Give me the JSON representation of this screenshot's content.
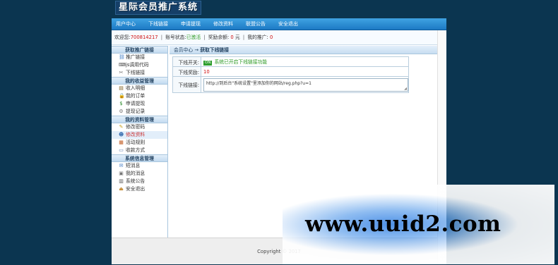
{
  "app": {
    "title": "星际会员推广系统"
  },
  "nav": [
    "用户中心",
    "下线链接",
    "申请提现",
    "修改资料",
    "联盟公告",
    "安全退出"
  ],
  "info": {
    "welcome": "欢迎您:",
    "user": "700814217",
    "status_label": "账号状态:",
    "status_value": "已激活",
    "reward_label": "奖励余额:",
    "reward_value": "0",
    "unit": "元",
    "promo_label": "我的推广:",
    "promo_value": "0"
  },
  "sidebar": [
    {
      "header": "获取推广链接",
      "items": [
        {
          "label": "推广链接",
          "icon": "link-icon"
        },
        {
          "label": "js调用代码",
          "icon": "code-icon"
        },
        {
          "label": "下线链接",
          "icon": "tools-icon"
        }
      ]
    },
    {
      "header": "我的收益管理",
      "items": [
        {
          "label": "收入明细",
          "icon": "document-icon"
        },
        {
          "label": "我的订单",
          "icon": "lock-icon"
        },
        {
          "label": "申请提现",
          "icon": "money-icon"
        },
        {
          "label": "提现记录",
          "icon": "gear-icon"
        }
      ]
    },
    {
      "header": "我的资料管理",
      "items": [
        {
          "label": "修改密码",
          "icon": "pencil-icon"
        },
        {
          "label": "修改资料",
          "icon": "users-icon"
        },
        {
          "label": "活动规则",
          "icon": "rules-icon"
        },
        {
          "label": "收款方式",
          "icon": "card-icon"
        }
      ]
    },
    {
      "header": "系统信息管理",
      "items": [
        {
          "label": "短消息",
          "icon": "message-icon"
        },
        {
          "label": "我的消息",
          "icon": "inbox-icon"
        },
        {
          "label": "系统公告",
          "icon": "notice-icon"
        },
        {
          "label": "安全退出",
          "icon": "logout-icon"
        }
      ]
    }
  ],
  "sidebar_active": "修改资料",
  "crumb": {
    "home": "会员中心",
    "arrow": "→",
    "current": "获取下线链接"
  },
  "form": {
    "switch_label": "下线开关:",
    "switch_badge": "ON",
    "switch_text": "系统已开启下线链接功能",
    "reward_label": "下线奖励:",
    "reward_value": "10",
    "link_label": "下线链接:",
    "link_value": "http://到后台\"系统设置\"里添加你的网站/reg.php?u=1"
  },
  "footer": {
    "text": "Copyright © 2017"
  },
  "watermark": {
    "text": "www.uuid2.com"
  },
  "colors": {
    "accent": "#1d79c4",
    "active_status": "#2f9b26",
    "value_red": "#d01010"
  }
}
